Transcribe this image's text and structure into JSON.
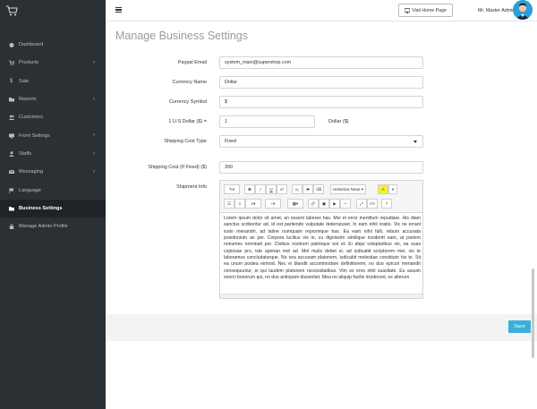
{
  "sidebar": {
    "items": [
      {
        "label": "Dashboard",
        "icon": "dashboard-icon",
        "has_arrow": false
      },
      {
        "label": "Products",
        "icon": "cart-icon",
        "has_arrow": true
      },
      {
        "label": "Sale",
        "icon": "dollar-icon",
        "has_arrow": false
      },
      {
        "label": "Reports",
        "icon": "folder-icon",
        "has_arrow": true
      },
      {
        "label": "Customers",
        "icon": "users-icon",
        "has_arrow": false
      },
      {
        "label": "Front Settings",
        "icon": "desktop-icon",
        "has_arrow": true
      },
      {
        "label": "Staffs",
        "icon": "user-icon",
        "has_arrow": true
      },
      {
        "label": "Messaging",
        "icon": "envelope-icon",
        "has_arrow": true
      },
      {
        "label": "Language",
        "icon": "flag-icon",
        "has_arrow": false
      },
      {
        "label": "Business Settings",
        "icon": "folder-icon",
        "has_arrow": false,
        "active": true
      },
      {
        "label": "Manage Admin Profile",
        "icon": "lock-icon",
        "has_arrow": false
      }
    ]
  },
  "header": {
    "visit_label": "Visit Home Page",
    "user_name": "Mr. Master Admin"
  },
  "page": {
    "title": "Manage Business Settings"
  },
  "form": {
    "paypal_label": "Paypal Email",
    "paypal_value": "system_main@supershop.com",
    "currency_name_label": "Currency Name",
    "currency_name_value": "Dollar",
    "currency_symbol_label": "Currency Symbol",
    "currency_symbol_value": "$",
    "usd_label": "1 U.S Dollar ($) =",
    "usd_value": "1",
    "usd_suffix": "Dollar ($)",
    "shipping_type_label": "Shipping Cost Type",
    "shipping_type_value": "Fixed",
    "shipping_cost_label": "Shipping Cost (If Fixed) ($)",
    "shipping_cost_value": "300",
    "shipment_info_label": "Shipment Info"
  },
  "editor": {
    "font_name": "Helvetica Neue",
    "content": "Lorem ipsum dolor sit amet, an essent labores has. Mei et error mentitum repudiare. His diam sanctus scribentur ad, id est partiendo vulputate deterruisset. In eam nihil oratio. Vix ne errant iusto menandri, ad latine numquam repromique has. Ea eam nihil falli, rebum accusata posidonium an per. Corpora lucilius vis in, cu dignissim similique incideritt eam, at partem nonumes nominati per. Civibus nostrum patrioque est et. Ei atqui voluptaribus vix, ea suas copiosae pro, iste aperian mel ad. Mel mulis debet ei, ad iudicabit scriptorem mei, vix te laboramus concludaturque. No sea accusam platonem, iudicabit molestiae constituto his te. Sit ea unum postea eirmod. Nec ei blandit accommodare definitionem, no duo epicuri menandri consequuntur, ei qui laudem platonem necessitatibus. Vim ex eros nihil suavitate. Eu assum exerci bonorum qui, no duo antiopam dissentiet. Mea no aliquip facilis inciderunt, ex alterum"
  },
  "footer": {
    "save_label": "Save"
  },
  "colors": {
    "sidebar_bg": "#2b3035",
    "accent": "#3bafda"
  }
}
